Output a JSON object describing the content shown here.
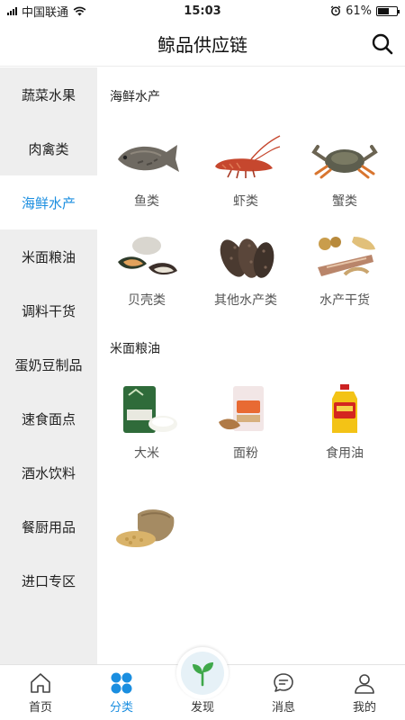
{
  "status_bar": {
    "carrier": "中国联通",
    "time": "15:03",
    "battery": "61%",
    "battery_level": 0.61
  },
  "header": {
    "title": "鲸品供应链"
  },
  "sidebar": {
    "items": [
      {
        "label": "蔬菜水果"
      },
      {
        "label": "肉禽类"
      },
      {
        "label": "海鲜水产"
      },
      {
        "label": "米面粮油"
      },
      {
        "label": "调料干货"
      },
      {
        "label": "蛋奶豆制品"
      },
      {
        "label": "速食面点"
      },
      {
        "label": "酒水饮料"
      },
      {
        "label": "餐厨用品"
      },
      {
        "label": "进口专区"
      }
    ],
    "active_index": 2
  },
  "sections": [
    {
      "title": "海鲜水产",
      "items": [
        {
          "label": "鱼类",
          "icon": "fish-icon"
        },
        {
          "label": "虾类",
          "icon": "lobster-icon"
        },
        {
          "label": "蟹类",
          "icon": "crab-icon"
        },
        {
          "label": "贝壳类",
          "icon": "shellfish-icon"
        },
        {
          "label": "其他水产类",
          "icon": "sea-cucumber-icon"
        },
        {
          "label": "水产干货",
          "icon": "dried-seafood-icon"
        }
      ]
    },
    {
      "title": "米面粮油",
      "items": [
        {
          "label": "大米",
          "icon": "rice-bag-icon"
        },
        {
          "label": "面粉",
          "icon": "flour-bag-icon"
        },
        {
          "label": "食用油",
          "icon": "oil-bottle-icon"
        },
        {
          "label": "",
          "icon": "grain-sack-icon"
        }
      ]
    }
  ],
  "tabbar": {
    "tabs": [
      {
        "label": "首页",
        "icon": "home-icon"
      },
      {
        "label": "分类",
        "icon": "category-icon"
      },
      {
        "label": "发现",
        "icon": "sprout-icon"
      },
      {
        "label": "消息",
        "icon": "message-icon"
      },
      {
        "label": "我的",
        "icon": "profile-icon"
      }
    ],
    "active_index": 1
  },
  "colors": {
    "accent": "#1a8ee0",
    "sidebar_bg": "#eeeeee",
    "discover_green": "#3fa84a"
  }
}
